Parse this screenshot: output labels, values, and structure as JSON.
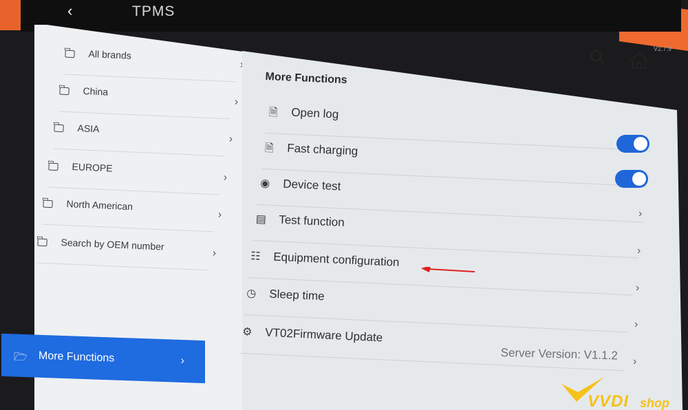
{
  "app": {
    "title": "TPMS",
    "version_tag": "V2.7.9"
  },
  "header": {
    "search_icon": "search-icon",
    "home_icon": "home-icon"
  },
  "sidebar": {
    "items": [
      {
        "label": "All brands",
        "icon": "folder-icon"
      },
      {
        "label": "China",
        "icon": "folder-icon"
      },
      {
        "label": "ASIA",
        "icon": "folder-icon"
      },
      {
        "label": "EUROPE",
        "icon": "folder-icon"
      },
      {
        "label": "North American",
        "icon": "folder-icon"
      },
      {
        "label": "Search by OEM number",
        "icon": "folder-icon"
      }
    ],
    "active": {
      "label": "More Functions",
      "icon": "folder-open-icon"
    }
  },
  "main": {
    "title": "More Functions",
    "rows": [
      {
        "label": "Open log",
        "icon": "log-icon",
        "control": "none"
      },
      {
        "label": "Fast charging",
        "icon": "charging-icon",
        "control": "toggle",
        "on": true
      },
      {
        "label": "Device test",
        "icon": "device-icon",
        "control": "toggle",
        "on": true
      },
      {
        "label": "Test function",
        "icon": "test-icon",
        "control": "chevron"
      },
      {
        "label": "Equipment configuration",
        "icon": "config-icon",
        "control": "chevron"
      },
      {
        "label": "Sleep time",
        "icon": "clock-icon",
        "control": "chevron"
      },
      {
        "label": "VT02Firmware Update",
        "icon": "chip-icon",
        "control": "chevron"
      }
    ],
    "server_version": "Server Version: V1.1.2"
  },
  "watermark": {
    "brand": "VVDI",
    "suffix": "shop"
  },
  "colors": {
    "accent": "#1f6be0",
    "frame": "#e8632c",
    "arrow": "#e02020",
    "watermark": "#f4c21a"
  }
}
